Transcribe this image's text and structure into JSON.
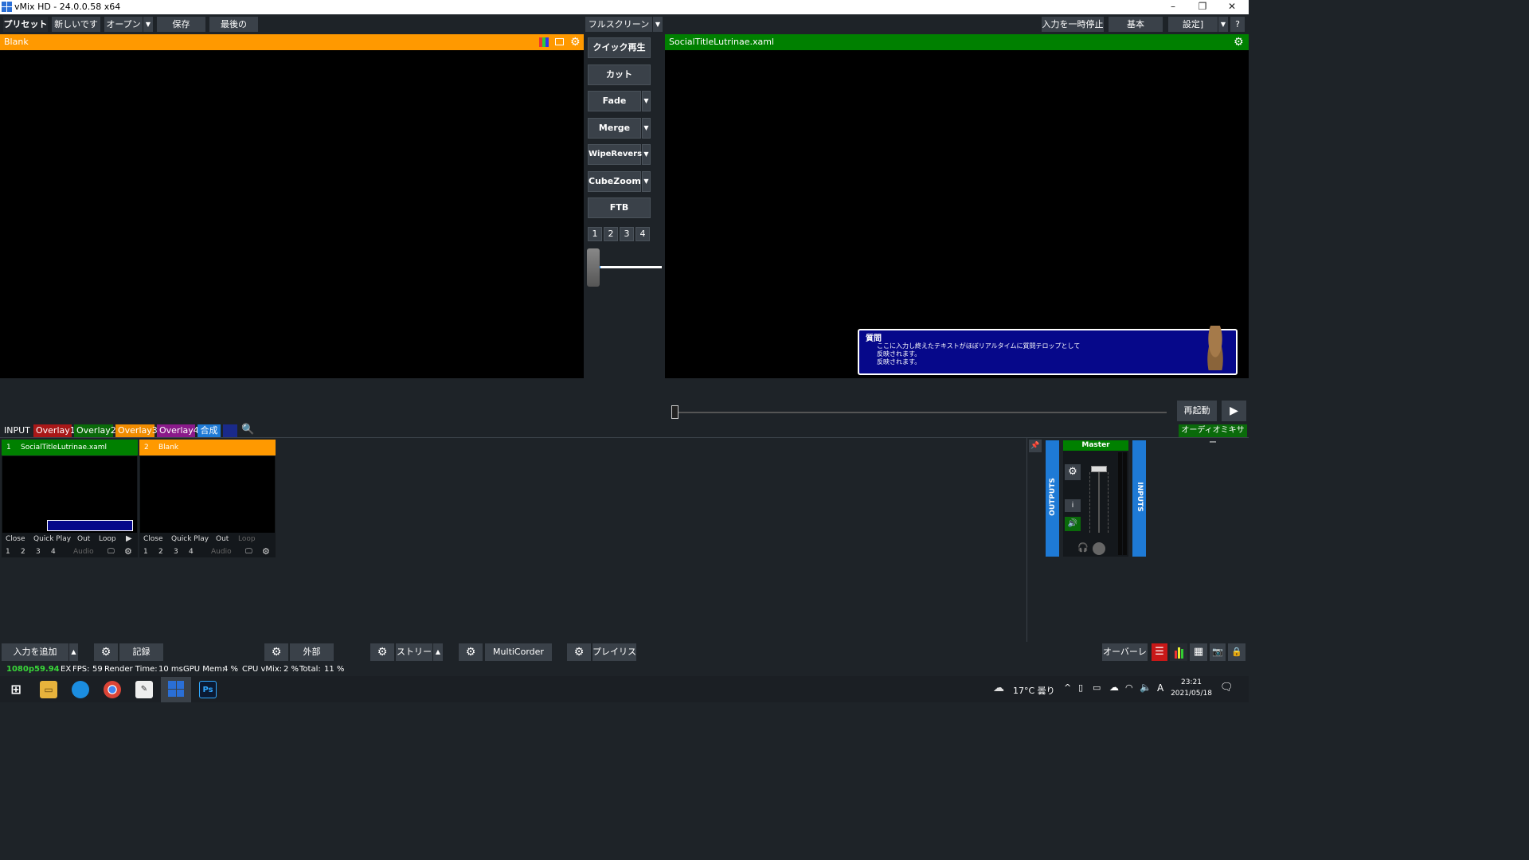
{
  "window": {
    "title": "vMix HD - 24.0.0.58 x64",
    "min": "–",
    "max": "❐",
    "close": "✕"
  },
  "toolbar": {
    "preset": "プリセット",
    "new": "新しいです",
    "open": "オープン",
    "save": "保存",
    "last": "最後の",
    "fullscreen": "フルスクリーン",
    "pause_input": "入力を一時停止",
    "basic": "基本",
    "settings": "設定]",
    "help": "?"
  },
  "preview": {
    "title": "Blank",
    "color": "#ff9900"
  },
  "output": {
    "title": "SocialTitleLutrinae.xaml",
    "color": "#008000",
    "lower_third": {
      "heading": "質問",
      "line1": "ここに入力し終えたテキストがほぼリアルタイムに質問テロップとして",
      "line2": "反映されます。",
      "line3": "反映されます。"
    },
    "restart": "再起動",
    "play": "▶"
  },
  "transitions": {
    "quick_play": "クイック再生",
    "cut": "カット",
    "items": [
      "Fade",
      "Merge",
      "WipeReverse",
      "CubeZoom"
    ],
    "ftb": "FTB",
    "numbers": [
      "1",
      "2",
      "3",
      "4"
    ]
  },
  "tabs": {
    "input": "INPUT",
    "overlay1": "Overlay1",
    "overlay2": "Overlay2",
    "overlay3": "Overlay3",
    "overlay4": "Overlay4",
    "composite": "合成",
    "audio_mixer": "オーディオミキサー"
  },
  "inputs": [
    {
      "number": "1",
      "name": "SocialTitleLutrinae.xaml",
      "color": "#008000",
      "buttons": [
        "Close",
        "Quick Play",
        "Out",
        "Loop"
      ],
      "overlays": [
        "1",
        "2",
        "3",
        "4"
      ],
      "audio": "Audio"
    },
    {
      "number": "2",
      "name": "Blank",
      "color": "#ff9900",
      "buttons": [
        "Close",
        "Quick Play",
        "Out",
        "Loop"
      ],
      "overlays": [
        "1",
        "2",
        "3",
        "4"
      ],
      "audio": "Audio"
    }
  ],
  "mixer": {
    "outputs": "OUTPUTS",
    "inputs": "INPUTS",
    "master": "Master",
    "info": "i"
  },
  "bottom": {
    "add_input": "入力を追加",
    "record": "記録",
    "external": "外部",
    "stream": "ストリーム",
    "multicorder": "MultiCorder",
    "playlist": "プレイリスト",
    "overlay": "オーバーレイ"
  },
  "status": {
    "format": "1080p59.94",
    "ex": "EX",
    "fps_label": "FPS:",
    "fps": "59",
    "render_label": "Render Time:",
    "render": "10 ms",
    "gpu_label": "GPU Mem:",
    "gpu": "4 %",
    "cpu_label": "CPU vMix:",
    "cpu": "2 %",
    "total_label": "Total:",
    "total": "11 %"
  },
  "taskbar": {
    "weather": "17°C 曇り",
    "time": "23:21",
    "date": "2021/05/18",
    "ime": "A"
  }
}
